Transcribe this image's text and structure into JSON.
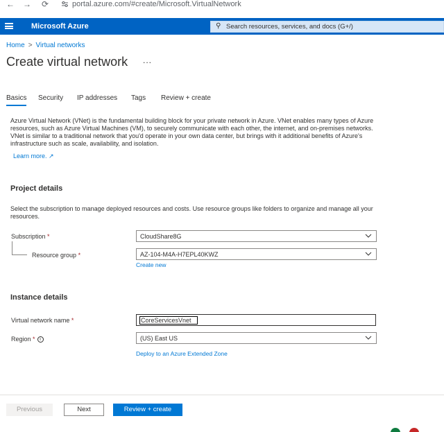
{
  "browser": {
    "back_icon": "←",
    "forward_icon": "→",
    "reload_icon": "⟳",
    "site_info_icon": "tune-icon",
    "url": "portal.azure.com/#create/Microsoft.VirtualNetwork"
  },
  "header": {
    "brand": "Microsoft Azure",
    "search_placeholder": "Search resources, services, and docs (G+/)",
    "accent_color": "#0063c3"
  },
  "breadcrumb": {
    "home": "Home",
    "separator": ">",
    "virtual_networks": "Virtual networks"
  },
  "page": {
    "title": "Create virtual network",
    "more": "..."
  },
  "tabs": [
    {
      "label": "Basics",
      "active": true
    },
    {
      "label": "Security",
      "active": false
    },
    {
      "label": "IP addresses",
      "active": false
    },
    {
      "label": "Tags",
      "active": false
    },
    {
      "label": "Review + create",
      "active": false
    }
  ],
  "intro": {
    "text": "Azure Virtual Network (VNet) is the fundamental building block for your private network in Azure. VNet enables many types of Azure resources, such as Azure Virtual Machines (VM), to securely communicate with each other, the internet, and on-premises networks. VNet is similar to a traditional network that you'd operate in your own data center, but brings with it additional benefits of Azure's infrastructure such as scale, availability, and isolation.",
    "learn_more": "Learn more. ↗"
  },
  "project_details": {
    "title": "Project details",
    "description": "Select the subscription to manage deployed resources and costs. Use resource groups like folders to organize and manage all your resources.",
    "subscription_label": "Subscription",
    "subscription_value": "CloudShare8G",
    "resource_group_label": "Resource group",
    "resource_group_value": "AZ-104-M4A-H7EPL40KWZ",
    "create_new": "Create new",
    "required_marker": "*"
  },
  "instance_details": {
    "title": "Instance details",
    "vnet_name_label": "Virtual network name",
    "vnet_name_value": "CoreServicesVnet",
    "region_label": "Region",
    "region_value": "(US) East US",
    "info_icon": "i",
    "extended_zone_link": "Deploy to an Azure Extended Zone",
    "required_marker": "*"
  },
  "footer": {
    "previous": "Previous",
    "next": "Next",
    "review_create": "Review + create"
  }
}
